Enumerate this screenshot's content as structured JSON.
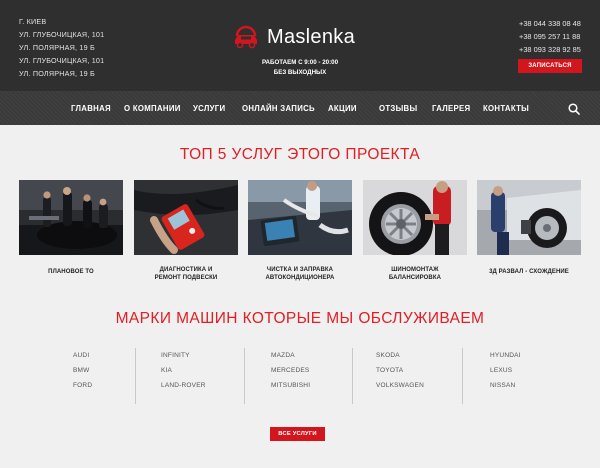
{
  "header": {
    "address_lines": [
      "Г. КИЕВ",
      "УЛ. ГЛУБОЧИЦКАЯ, 101",
      "УЛ. ПОЛЯРНАЯ, 19 Б",
      "УЛ. ГЛУБОЧИЦКАЯ, 101",
      "УЛ. ПОЛЯРНАЯ, 19 Б"
    ],
    "logo_text": "Maslenka",
    "hours_line1": "РАБОТАЕМ С 9:00 - 20:00",
    "hours_line2": "БЕЗ ВЫХОДНЫХ",
    "phones": [
      "+38 044 338 08 48",
      "+38 095 257 11 88",
      "+38 093 328 92 85"
    ],
    "book_button": "ЗАПИСАТЬСЯ"
  },
  "nav": {
    "items": [
      "ГЛАВНАЯ",
      "О КОМПАНИИ",
      "УСЛУГИ",
      "ОНЛАЙН ЗАПИСЬ",
      "АКЦИИ",
      "ОТЗЫВЫ",
      "ГАЛЕРЕЯ",
      "КОНТАКТЫ"
    ],
    "search_icon": "search-icon"
  },
  "services": {
    "title": "ТОП 5 УСЛУГ ЭТОГО ПРОЕКТА",
    "items": [
      {
        "line1": "ПЛАНОВОЕ ТО",
        "line2": ""
      },
      {
        "line1": "ДИАГНОСТИКА И",
        "line2": "РЕМОНТ ПОДВЕСКИ"
      },
      {
        "line1": "ЧИСТКА И ЗАПРАВКА",
        "line2": "АВТОКОНДИЦИОНЕРА"
      },
      {
        "line1": "ШИНОМОНТАЖ",
        "line2": "БАЛАНСИРОВКА"
      },
      {
        "line1": "3Д РАЗВАЛ - СХОЖДЕНИЕ",
        "line2": ""
      }
    ]
  },
  "brands": {
    "title": "МАРКИ МАШИН КОТОРЫЕ МЫ ОБСЛУЖИВАЕМ",
    "columns": [
      [
        "AUDI",
        "BMW",
        "FORD"
      ],
      [
        "INFINITY",
        "KIA",
        "LAND-ROVER"
      ],
      [
        "MAZDA",
        "MERCEDES",
        "MITSUBISHI"
      ],
      [
        "SKODA",
        "TOYOTA",
        "VOLKSWAGEN"
      ],
      [
        "HYUNDAI",
        "LEXUS",
        "NISSAN"
      ]
    ],
    "all_button": "ВСЕ УСЛУГИ"
  },
  "colors": {
    "accent": "#d3161d",
    "header_bg": "#2f2f2f",
    "nav_bg": "#3a3a3a",
    "page_bg": "#f0f0f0"
  }
}
